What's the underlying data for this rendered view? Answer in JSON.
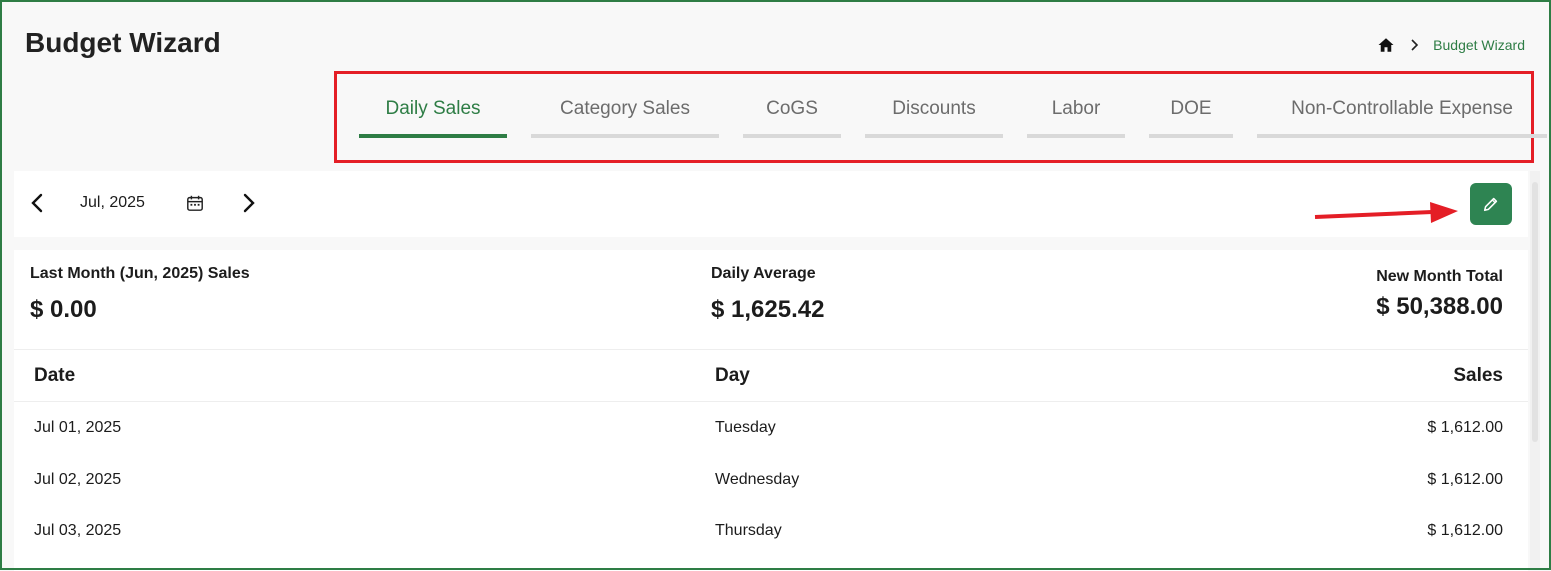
{
  "page": {
    "title": "Budget Wizard"
  },
  "breadcrumb": {
    "current": "Budget Wizard"
  },
  "tabs": [
    {
      "label": "Daily Sales",
      "active": true
    },
    {
      "label": "Category Sales"
    },
    {
      "label": "CoGS"
    },
    {
      "label": "Discounts"
    },
    {
      "label": "Labor"
    },
    {
      "label": "DOE"
    },
    {
      "label": "Non-Controllable Expense"
    }
  ],
  "toolbar": {
    "month": "Jul, 2025"
  },
  "summary": {
    "last_month_label": "Last Month (Jun, 2025) Sales",
    "last_month_value": "$ 0.00",
    "daily_avg_label": "Daily Average",
    "daily_avg_value": "$ 1,625.42",
    "new_total_label": "New Month Total",
    "new_total_value": "$ 50,388.00"
  },
  "table": {
    "headers": [
      "Date",
      "Day",
      "Sales"
    ],
    "rows": [
      {
        "date": "Jul 01, 2025",
        "day": "Tuesday",
        "sales": "$ 1,612.00"
      },
      {
        "date": "Jul 02, 2025",
        "day": "Wednesday",
        "sales": "$ 1,612.00"
      },
      {
        "date": "Jul 03, 2025",
        "day": "Thursday",
        "sales": "$ 1,612.00"
      }
    ]
  },
  "colors": {
    "accent": "#2e7d45",
    "highlight": "#e41e26"
  }
}
